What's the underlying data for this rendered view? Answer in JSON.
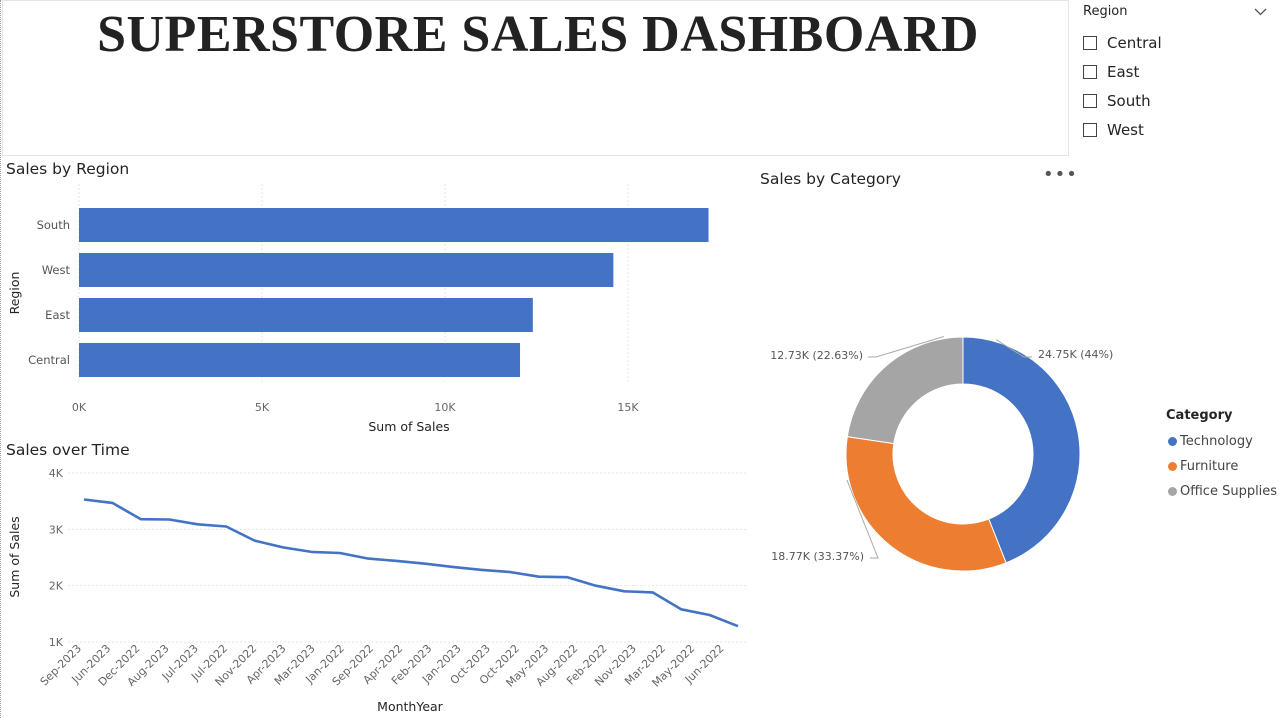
{
  "dashboard": {
    "title": "SUPERSTORE SALES DASHBOARD"
  },
  "slicer": {
    "label": "Region",
    "icon": "chevron-down-icon",
    "options": [
      "Central",
      "East",
      "South",
      "West"
    ]
  },
  "colors": {
    "technology": "#4472C4",
    "furniture": "#ED7D31",
    "office_supplies": "#A5A5A5",
    "bar": "#4472C4",
    "line": "#4472C4"
  },
  "chart_data": [
    {
      "type": "bar",
      "title": "Sales by Region",
      "orientation": "horizontal",
      "categories": [
        "South",
        "West",
        "East",
        "Central"
      ],
      "values": [
        17200,
        14600,
        12400,
        12050
      ],
      "xlabel": "Sum of Sales",
      "ylabel": "Region",
      "xlim": [
        0,
        19000
      ],
      "xticks": [
        0,
        5000,
        10000,
        15000
      ],
      "xtick_labels": [
        "0K",
        "5K",
        "10K",
        "15K"
      ],
      "grid": true
    },
    {
      "type": "line",
      "title": "Sales over Time",
      "x": [
        "Sep-2023",
        "Jun-2023",
        "Dec-2022",
        "Aug-2023",
        "Jul-2023",
        "Jul-2022",
        "Nov-2022",
        "Apr-2023",
        "Mar-2023",
        "Jan-2022",
        "Sep-2022",
        "Apr-2022",
        "Feb-2023",
        "Jan-2023",
        "Oct-2023",
        "Oct-2022",
        "May-2023",
        "Aug-2022",
        "Feb-2022",
        "Nov-2023",
        "Mar-2022",
        "May-2022",
        "Jun-2022"
      ],
      "values": [
        3530,
        3470,
        3180,
        3175,
        3090,
        3050,
        2800,
        2680,
        2600,
        2580,
        2480,
        2440,
        2390,
        2330,
        2280,
        2240,
        2160,
        2150,
        2000,
        1900,
        1880,
        1580,
        1480,
        1280
      ],
      "xlabel": "MonthYear",
      "ylabel": "Sum of Sales",
      "ylim": [
        1000,
        4000
      ],
      "yticks": [
        1000,
        2000,
        3000,
        4000
      ],
      "ytick_labels": [
        "1K",
        "2K",
        "3K",
        "4K"
      ],
      "grid": true
    },
    {
      "type": "pie",
      "subtype": "donut",
      "title": "Sales by Category",
      "legend_title": "Category",
      "legend_position": "right",
      "categories": [
        "Technology",
        "Furniture",
        "Office Supplies"
      ],
      "values": [
        24750,
        18770,
        12730
      ],
      "percents": [
        44,
        33.37,
        22.63
      ],
      "data_labels": [
        "24.75K (44%)",
        "18.77K (33.37%)",
        "12.73K (22.63%)"
      ]
    }
  ]
}
